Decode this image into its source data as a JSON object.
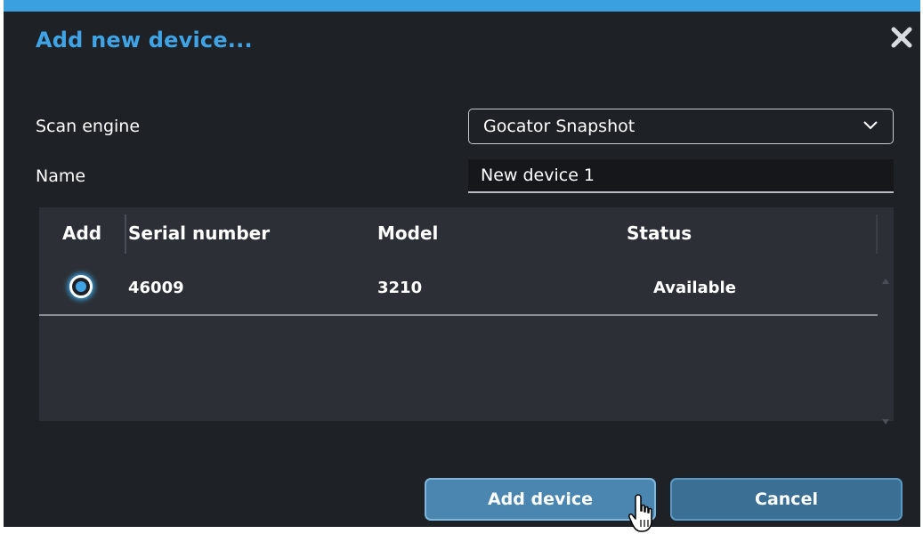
{
  "dialog": {
    "title": "Add new device...",
    "close_icon": "close-icon",
    "accent_color": "#3aa0e0"
  },
  "form": {
    "scan_engine_label": "Scan engine",
    "scan_engine_value": "Gocator Snapshot",
    "name_label": "Name",
    "name_value": "New device 1"
  },
  "table": {
    "columns": [
      "Add",
      "Serial number",
      "Model",
      "Status"
    ],
    "rows": [
      {
        "selected": true,
        "serial_number": "46009",
        "model": "3210",
        "status": "Available"
      }
    ]
  },
  "buttons": {
    "add_label": "Add device",
    "cancel_label": "Cancel"
  }
}
